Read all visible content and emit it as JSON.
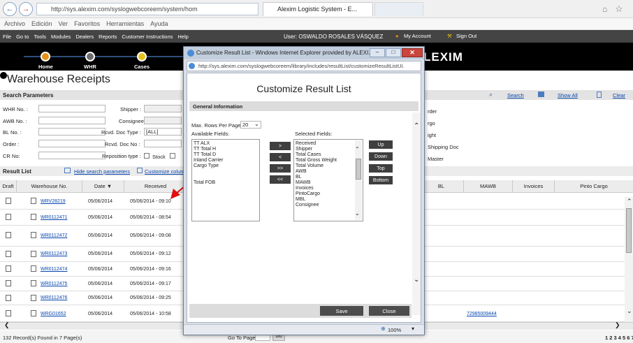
{
  "browser": {
    "address": "http://sys.alexim.com/syslogwebcoreem/system/hom",
    "tab_title": "Alexim Logistic System - E...",
    "menu": [
      "Archivo",
      "Edición",
      "Ver",
      "Favoritos",
      "Herramientas",
      "Ayuda"
    ]
  },
  "topbar": {
    "menu": [
      "File",
      "Go to",
      "Tools",
      "Modules",
      "Dealers",
      "Reports",
      "Customer Instructions",
      "Help"
    ],
    "user": "User: OSWALDO ROSALES VÁSQUEZ",
    "my_account": "My Account",
    "sign_out": "Sign Out"
  },
  "navband": {
    "items": [
      "Home",
      "WHR",
      "Cases"
    ],
    "brand": "LEXIM"
  },
  "page": {
    "title": "Warehouse Receipts",
    "search_section": "Search Parameters",
    "search_link": "Search",
    "show_all": "Show All",
    "clear": "Clear",
    "fields_left": [
      "WHR No. :",
      "AWB No. :",
      "BL No. :",
      "Order :",
      "CR No:"
    ],
    "fields_mid": [
      "Shipper :",
      "Consignee :",
      "Rcvd. Doc Type :",
      "Rcvd. Doc No :",
      "Reposition type :"
    ],
    "doc_type_value": "[ALL]",
    "stock_label": "Stock",
    "right_labels": [
      "rder",
      "rgo",
      "ight",
      "Shipping Doc",
      "Master"
    ],
    "result_section": "Result List",
    "hide_params": "Hide search parameters",
    "customize": "Customize colum"
  },
  "table": {
    "headers": [
      "Draft",
      "Warehouse No.",
      "Date ▼",
      "Received",
      "BL",
      "MAWB",
      "Invoices",
      "Pinto Cargo"
    ],
    "rows": [
      {
        "whr": "WRV28219",
        "date": "05/06/2014",
        "received": "05/06/2014 - 09:10",
        "mawb": ""
      },
      {
        "whr": "WR0112471",
        "date": "05/06/2014",
        "received": "05/06/2014 - 08:54",
        "mawb": ""
      },
      {
        "whr": "WR0112472",
        "date": "05/06/2014",
        "received": "05/06/2014 - 09:08",
        "mawb": ""
      },
      {
        "whr": "WR0112473",
        "date": "05/06/2014",
        "received": "05/06/2014 - 09:12",
        "mawb": ""
      },
      {
        "whr": "WR0112474",
        "date": "05/06/2014",
        "received": "05/06/2014 - 09:16",
        "mawb": ""
      },
      {
        "whr": "WR0112475",
        "date": "05/06/2014",
        "received": "05/06/2014 - 09:17",
        "mawb": ""
      },
      {
        "whr": "WR0112476",
        "date": "05/06/2014",
        "received": "05/06/2014 - 09:25",
        "mawb": ""
      },
      {
        "whr": "WRG01652",
        "date": "05/06/2014",
        "received": "05/06/2014 - 10:58",
        "mawb": "72985009444"
      }
    ],
    "footer": "132 Record(s) Found in 7 Page(s)",
    "go_to_page": "Go To Page:",
    "go": "Go",
    "pages": "1 2 3 4 5 6 7"
  },
  "modal": {
    "window_title": "Customize Result List - Windows Internet Explorer provided by ALEXI...",
    "address": "http://sys.alexim.com/syslogwebcoreem/library/includes/resultList/customizeResultListUI.",
    "heading": "Customize Result List",
    "section": "General Information",
    "max_rows_label": "Max. Rows Per Page:",
    "max_rows_value": "20",
    "available_label": "Available Fields:",
    "selected_label": "Selected Fields:",
    "available_fields": [
      "TT ALX",
      "TT Total H",
      "TT Total D",
      "Inland Carrier",
      "Cargo Type",
      "",
      "",
      "Total FOB"
    ],
    "selected_fields": [
      "Received",
      "Shipper",
      "Total Cases",
      "Total Gross Weight",
      "Total Volume",
      "AWB",
      "BL",
      "MAWB",
      "Invoices",
      "PintoCargo",
      "MBL",
      "Consignee"
    ],
    "move_buttons": [
      ">",
      "<",
      ">>",
      "<<"
    ],
    "order_buttons": [
      "Up",
      "Down",
      "Top",
      "Bottom"
    ],
    "save": "Save",
    "close": "Close",
    "zoom": "100%"
  },
  "colors": {
    "accent_dark": "#000000",
    "nav_line": "#2e4f7a",
    "dot_orange": "#e8901a",
    "dot_yellow": "#e5c21a",
    "arrow_red": "#e01010"
  }
}
